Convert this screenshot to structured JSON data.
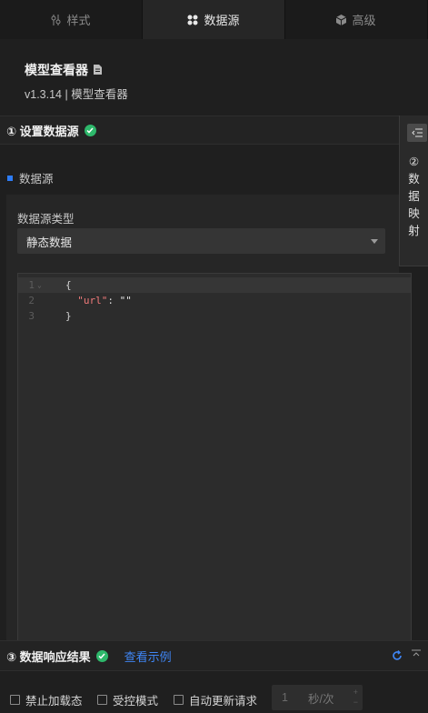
{
  "tabs": [
    {
      "label": "样式",
      "icon": "sliders-icon"
    },
    {
      "label": "数据源",
      "icon": "datasource-icon"
    },
    {
      "label": "高级",
      "icon": "cube-icon"
    }
  ],
  "header": {
    "title": "模型查看器",
    "version": "v1.3.14 | 模型查看器"
  },
  "section1": {
    "label": "① 设置数据源"
  },
  "datasource": {
    "label": "数据源",
    "type_label": "数据源类型",
    "type_value": "静态数据",
    "code_lines": [
      "1",
      "2",
      "3"
    ],
    "code": {
      "open": "{",
      "key": "\"url\"",
      "colon": ": ",
      "value": "\"\"",
      "close": "}"
    }
  },
  "side": {
    "label": "② 数据映射"
  },
  "section3": {
    "label": "③ 数据响应结果",
    "link": "查看示例"
  },
  "bottom": {
    "disable_loading": "禁止加载态",
    "controlled": "受控模式",
    "auto_update": "自动更新请求",
    "interval_value": "1",
    "interval_unit": "秒/次"
  },
  "colors": {
    "accent": "#3f86f5",
    "success": "#2eb86b",
    "code_key": "#f07a7a"
  }
}
